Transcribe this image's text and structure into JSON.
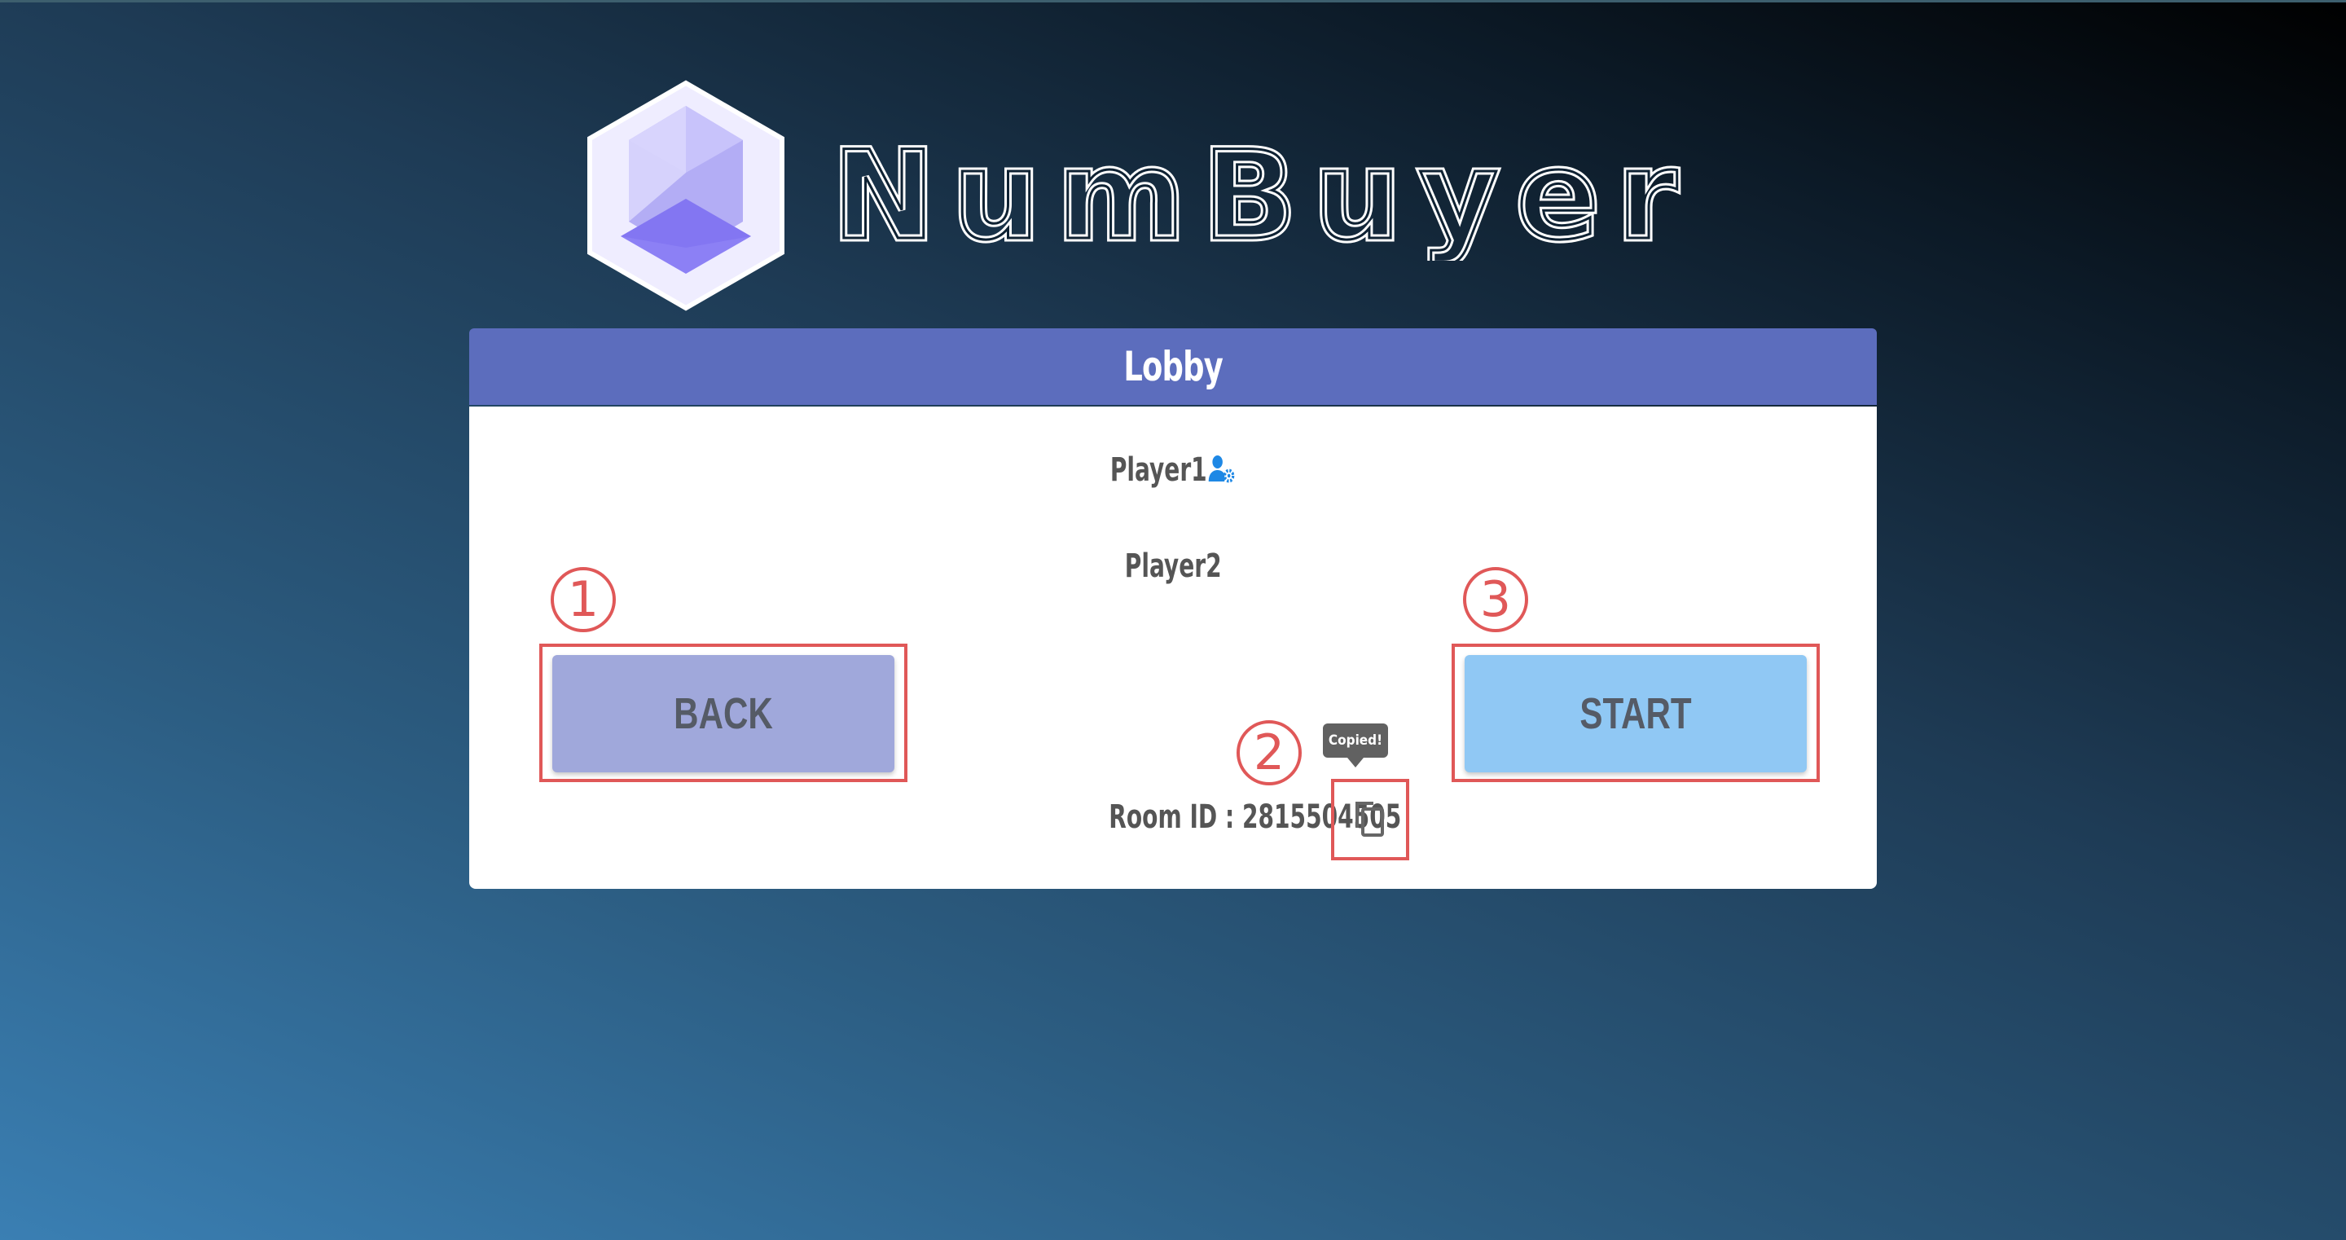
{
  "app": {
    "logo_text": "NumBuyer"
  },
  "lobby": {
    "title": "Lobby",
    "players": [
      {
        "name": "Player1",
        "is_host": true
      },
      {
        "name": "Player2",
        "is_host": false
      }
    ],
    "back_label": "BACK",
    "start_label": "START",
    "room_id_text": "Room ID : 2815504505",
    "copy_icon": "copy-icon",
    "tooltip_text": "Copied!"
  },
  "annotations": [
    "1",
    "2",
    "3"
  ],
  "colors": {
    "header": "#5c6dbd",
    "back_button": "#a0a8db",
    "start_button": "#90c8f4",
    "annotation": "#e05858",
    "host_icon": "#1e88e5"
  }
}
